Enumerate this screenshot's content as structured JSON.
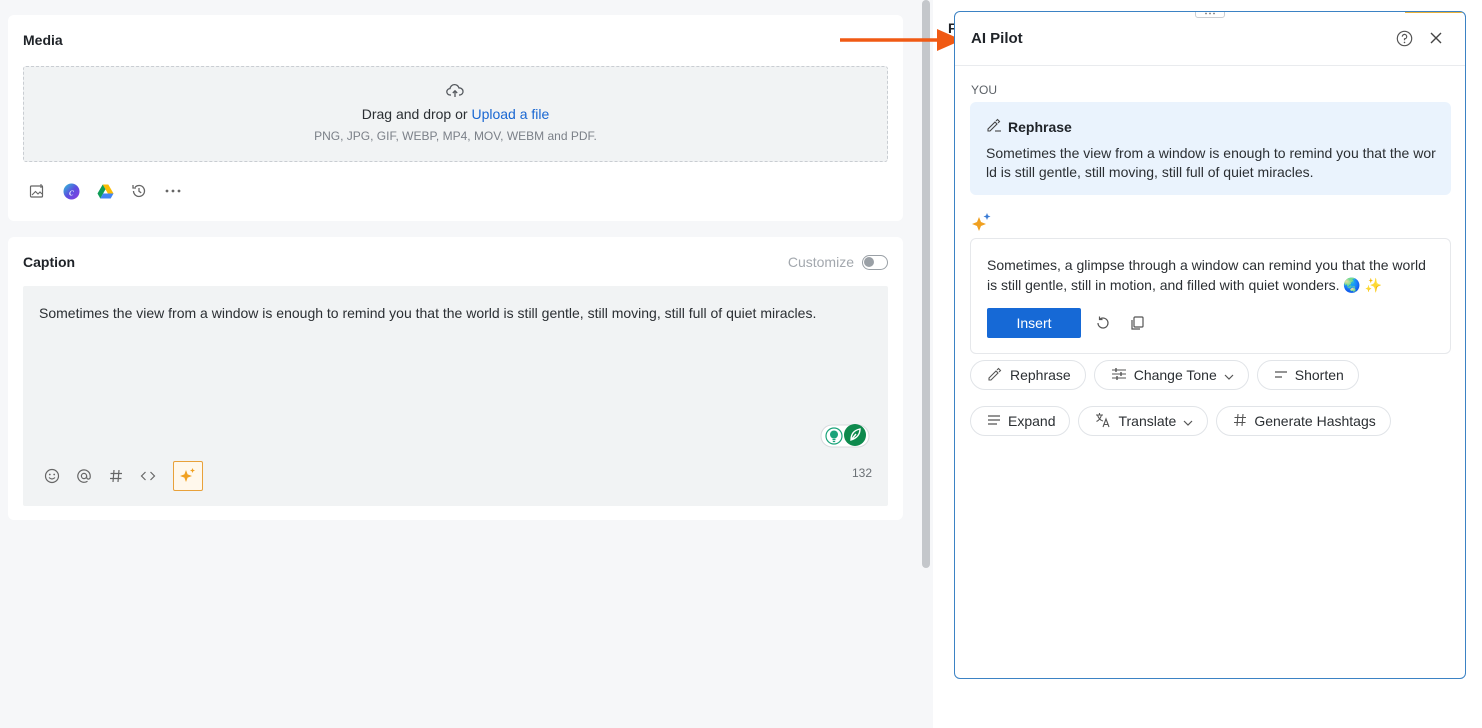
{
  "media": {
    "title": "Media",
    "dropzone": {
      "prompt": "Drag and drop or",
      "upload_link": "Upload a file",
      "formats": "PNG, JPG, GIF, WEBP, MP4, MOV, WEBM and PDF."
    },
    "tools": [
      "image-edit-icon",
      "canva-icon",
      "google-drive-icon",
      "history-icon",
      "more-icon"
    ]
  },
  "caption": {
    "title": "Caption",
    "customize_label": "Customize",
    "customize_on": false,
    "text": "Sometimes the view from a window is enough to remind you that the world is still gentle, still moving, still full of quiet miracles.",
    "char_count": "132",
    "tools": [
      "emoji-icon",
      "mention-icon",
      "hashtag-icon",
      "code-icon",
      "ai-sparkle-icon"
    ]
  },
  "right_panel_peek": "F",
  "ai_pilot": {
    "title": "AI Pilot",
    "you_label": "YOU",
    "request": {
      "action": "Rephrase",
      "text": "Sometimes the view from a window is enough to remind you that the world is still gentle, still moving, still full of quiet miracles."
    },
    "response": {
      "text": "Sometimes, a glimpse through a window can remind you that the world is still gentle, still in motion, and filled with quiet wonders. 🌏 ✨",
      "insert_label": "Insert"
    },
    "actions": {
      "rephrase": "Rephrase",
      "change_tone": "Change Tone",
      "shorten": "Shorten",
      "expand": "Expand",
      "translate": "Translate",
      "generate_hashtags": "Generate Hashtags"
    }
  },
  "colors": {
    "accent": "#1669d6",
    "arrow": "#f05a14",
    "sparkle": "#f0a020",
    "user_bubble": "#eaf3fd"
  }
}
